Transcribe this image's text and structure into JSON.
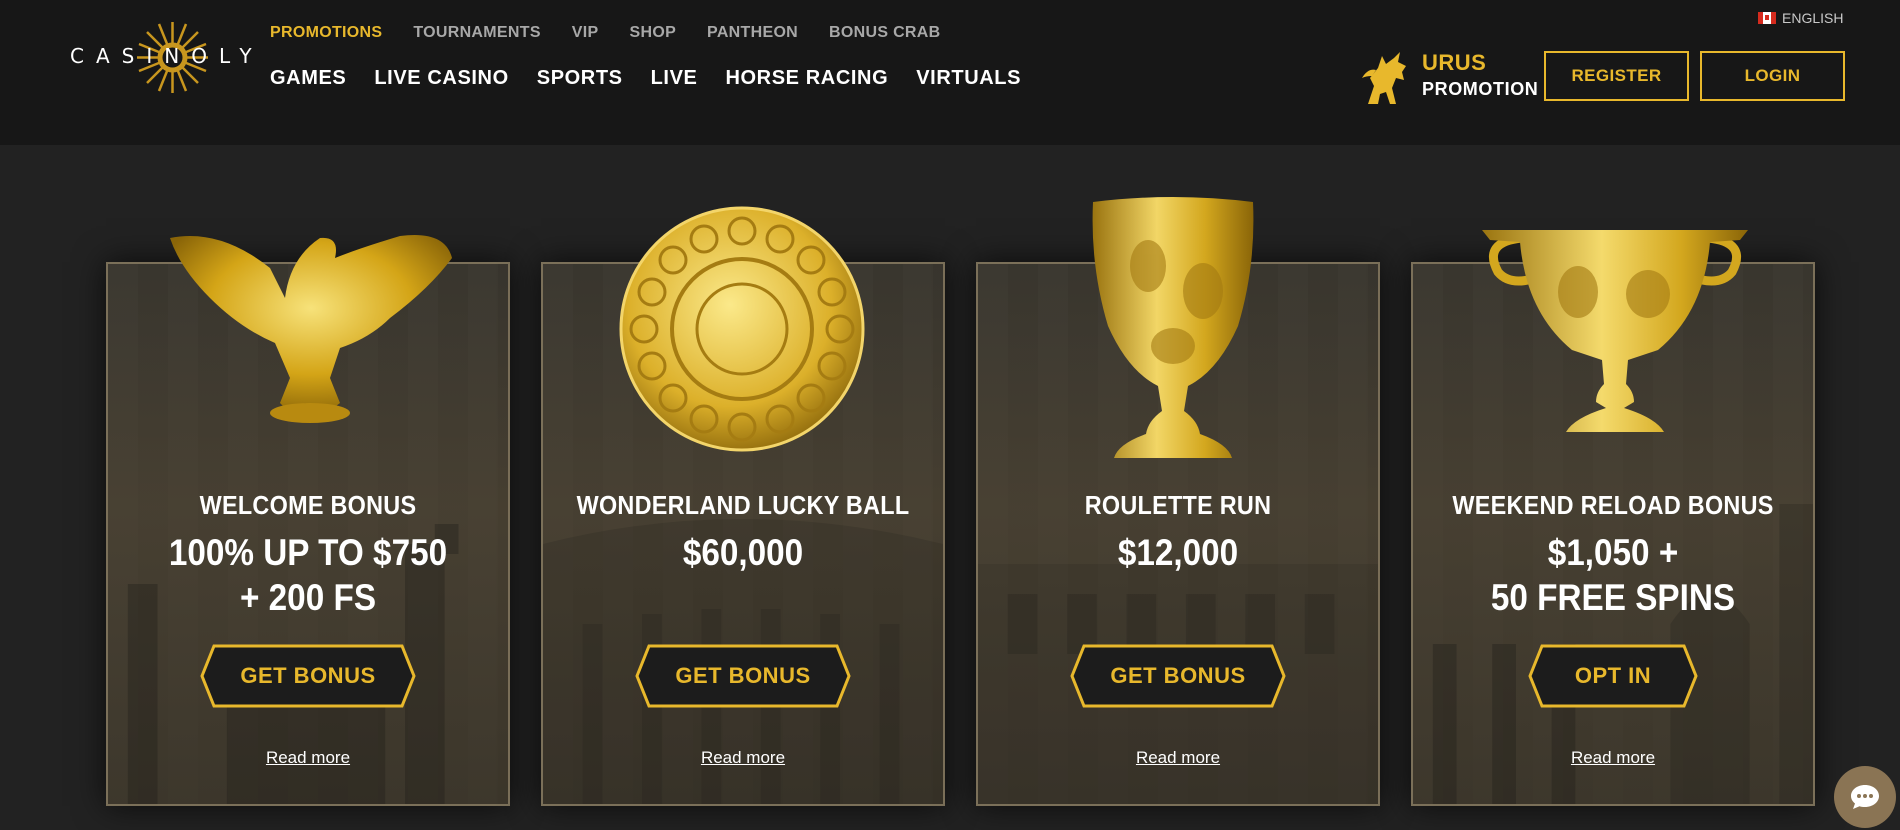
{
  "brand": {
    "logo_text": "CASINOLY"
  },
  "header": {
    "language": "ENGLISH",
    "top_nav": [
      {
        "label": "PROMOTIONS",
        "active": true
      },
      {
        "label": "TOURNAMENTS"
      },
      {
        "label": "VIP"
      },
      {
        "label": "SHOP"
      },
      {
        "label": "PANTHEON"
      },
      {
        "label": "BONUS CRAB"
      }
    ],
    "main_nav": [
      "GAMES",
      "LIVE CASINO",
      "SPORTS",
      "LIVE",
      "HORSE RACING",
      "VIRTUALS"
    ],
    "promo": {
      "line1": "URUS",
      "line2": "PROMOTION"
    },
    "register_label": "REGISTER",
    "login_label": "LOGIN"
  },
  "colors": {
    "accent": "#e8b82c",
    "header_bg": "#171717",
    "page_bg": "#222222"
  },
  "cards": [
    {
      "artifact": "eagle-icon",
      "title": "WELCOME BONUS",
      "amount_line1": "100% UP TO $750",
      "amount_line2": "+ 200 FS",
      "button": "GET BONUS",
      "link": "Read more"
    },
    {
      "artifact": "coin-icon",
      "title": "WONDERLAND LUCKY BALL",
      "amount_line1": "$60,000",
      "amount_line2": "",
      "button": "GET BONUS",
      "link": "Read more"
    },
    {
      "artifact": "goblet-icon",
      "title": "ROULETTE RUN",
      "amount_line1": "$12,000",
      "amount_line2": "",
      "button": "GET BONUS",
      "link": "Read more"
    },
    {
      "artifact": "cup-icon",
      "title": "WEEKEND RELOAD BONUS",
      "amount_line1": "$1,050 +",
      "amount_line2": "50 FREE SPINS",
      "button": "OPT IN",
      "link": "Read more"
    }
  ],
  "chat": {
    "icon": "chat-icon"
  }
}
